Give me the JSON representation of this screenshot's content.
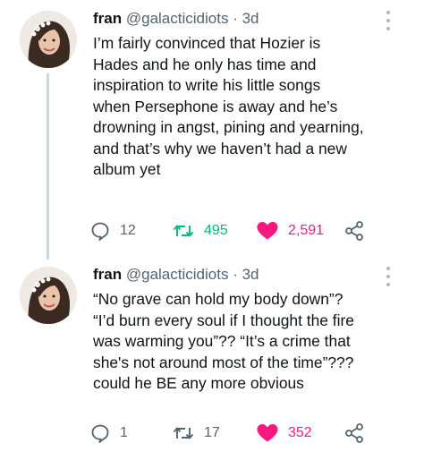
{
  "tweets": [
    {
      "display_name": "fran",
      "handle": "@galacticidiots",
      "separator": "·",
      "time": "3d",
      "lines": [
        "I’m fairly convinced that Hozier is",
        "Hades and he only has time and",
        "inspiration to write his little songs",
        "when Persephone is away and he’s",
        "drowning in angst, pining and yearning,",
        "and that’s why we haven’t had a new",
        "album yet"
      ],
      "replies": "12",
      "retweets": "495",
      "likes": "2,591"
    },
    {
      "display_name": "fran",
      "handle": "@galacticidiots",
      "separator": "·",
      "time": "3d",
      "lines": [
        "“No grave can hold my body down”?",
        "“I’d burn every soul if I thought the fire",
        "was warming you”?? “It’s a crime that",
        "she's not around most of the time”???",
        "could he BE any more obvious"
      ],
      "replies": "1",
      "retweets": "17",
      "likes": "352"
    }
  ],
  "icons": {
    "reply": "speech-bubble-icon",
    "retweet": "retweet-arrows-icon",
    "like": "heart-icon",
    "share": "share-nodes-icon",
    "more": "vertical-dots-icon"
  },
  "colors": {
    "text": "#0f1419",
    "muted": "#536471",
    "retweet": "#00ba7c",
    "like": "#f91880",
    "thread_line": "#cfd9de"
  }
}
